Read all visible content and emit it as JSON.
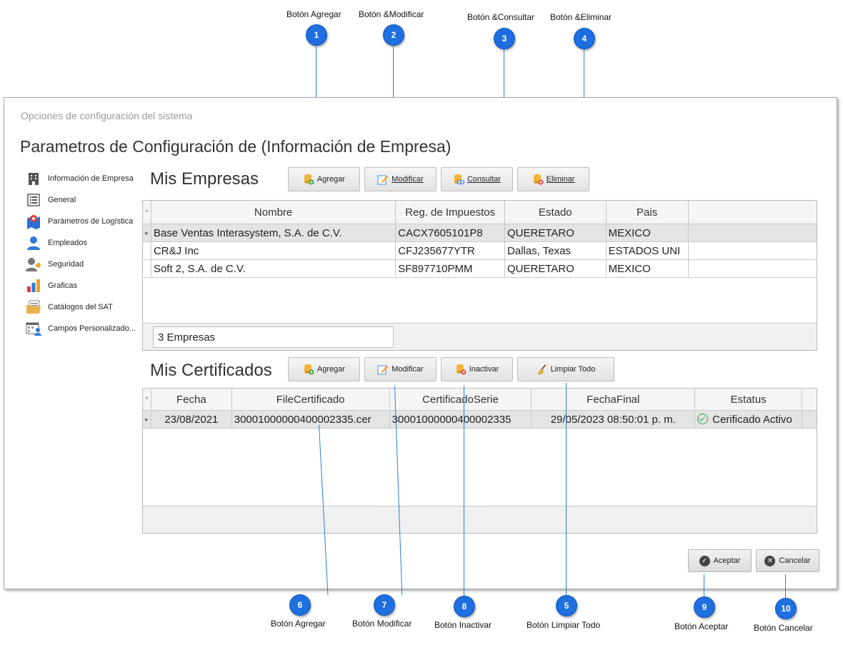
{
  "callouts": {
    "top": [
      {
        "num": "1",
        "label": "Botón Agregar"
      },
      {
        "num": "2",
        "label": "Botón &Modificar"
      },
      {
        "num": "3",
        "label": "Botón &Consultar"
      },
      {
        "num": "4",
        "label": "Botón &Eliminar"
      }
    ],
    "bottom": [
      {
        "num": "6",
        "label": "Botón Agregar"
      },
      {
        "num": "7",
        "label": "Botón Modificar"
      },
      {
        "num": "8",
        "label": "Botón Inactivar"
      },
      {
        "num": "5",
        "label": "Botón Limpiar Todo"
      },
      {
        "num": "9",
        "label": "Botón Aceptar"
      },
      {
        "num": "10",
        "label": "Botón Cancelar"
      }
    ]
  },
  "window": {
    "title": "Opciones de configuración del sistema",
    "heading": "Parametros de Configuración de (Información de Empresa)"
  },
  "sidebar": {
    "items": [
      {
        "label": "Información de Empresa",
        "icon": "building-icon"
      },
      {
        "label": "General",
        "icon": "list-icon"
      },
      {
        "label": "Parámetros de Logística",
        "icon": "map-pin-icon"
      },
      {
        "label": "Empleados",
        "icon": "user-icon"
      },
      {
        "label": "Seguridad",
        "icon": "user-key-icon"
      },
      {
        "label": "Graficas",
        "icon": "bar-chart-icon"
      },
      {
        "label": "Catálogos del SAT",
        "icon": "folder-doc-icon"
      },
      {
        "label": "Campos Personalizado...",
        "icon": "form-user-icon"
      }
    ]
  },
  "empresas": {
    "title": "Mis Empresas",
    "buttons": {
      "agregar": "Agregar",
      "modificar": "Modificar",
      "consultar": "Consultar",
      "eliminar": "Eliminar"
    },
    "columns": [
      "Nombre",
      "Reg. de Impuestos",
      "Estado",
      "Pais"
    ],
    "rows": [
      [
        "Base Ventas Interasystem, S.A. de C.V.",
        "CACX7605101P8",
        "QUERETARO",
        "MEXICO"
      ],
      [
        "CR&J Inc",
        "CFJ235677YTR",
        "Dallas, Texas",
        "ESTADOS UNI"
      ],
      [
        "Soft 2, S.A. de C.V.",
        "SF897710PMM",
        "QUERETARO",
        "MEXICO"
      ]
    ],
    "count": "3 Empresas"
  },
  "certificados": {
    "title": "Mis Certificados",
    "buttons": {
      "agregar": "Agregar",
      "modificar": "Modificar",
      "inactivar": "Inactivar",
      "limpiar": "Limpiar Todo"
    },
    "columns": [
      "Fecha",
      "FileCertificado",
      "CertificadoSerie",
      "FechaFinal",
      "Estatus"
    ],
    "rows": [
      [
        "23/08/2021",
        "30001000000400002335.cer",
        "30001000000400002335",
        "29/05/2023 08:50:01 p. m.",
        "Cerificado Activo"
      ]
    ]
  },
  "footer": {
    "aceptar": "Aceptar",
    "cancelar": "Cancelar"
  },
  "colors": {
    "accent": "#1e6fe0",
    "selected_row": "#e4e4e4",
    "status_ok": "#35a852"
  }
}
